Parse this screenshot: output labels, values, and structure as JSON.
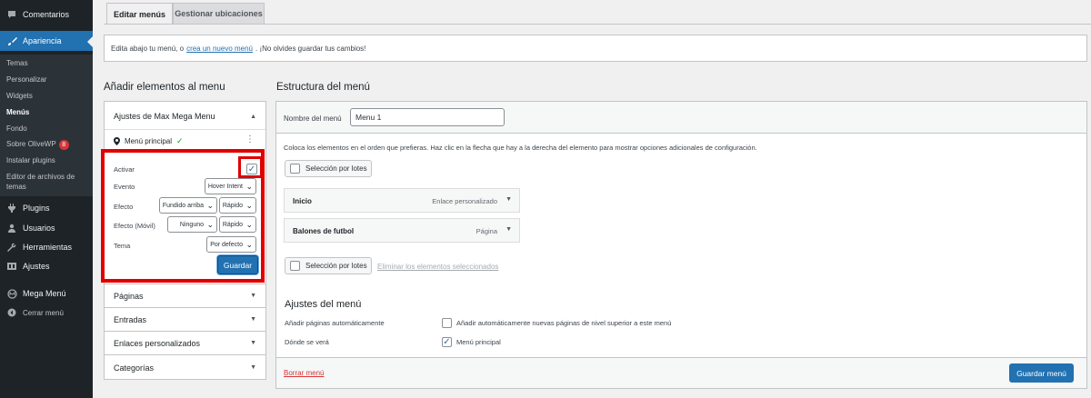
{
  "sidebar": {
    "top_items": [
      {
        "label": "Comentarios",
        "icon": "comment-icon"
      },
      {
        "label": "Apariencia",
        "icon": "brush-icon"
      }
    ],
    "sub_items": [
      "Temas",
      "Personalizar",
      "Widgets",
      "Menús",
      "Fondo",
      "Sobre OliveWP",
      "Instalar plugins",
      "Editor de archivos de temas"
    ],
    "badge": "8",
    "bottom_items": [
      {
        "label": "Plugins",
        "icon": "plugin-icon"
      },
      {
        "label": "Usuarios",
        "icon": "user-icon"
      },
      {
        "label": "Herramientas",
        "icon": "wrench-icon"
      },
      {
        "label": "Ajustes",
        "icon": "settings-icon"
      },
      {
        "label": "Mega Menú",
        "icon": "megamenu-icon"
      },
      {
        "label": "Cerrar menú",
        "icon": "collapse-icon"
      }
    ]
  },
  "tabs": [
    "Editar menús",
    "Gestionar ubicaciones"
  ],
  "notice": {
    "before": "Edita abajo tu menú, o",
    "link": "crea un nuevo menú",
    "after": ". ¡No olvides guardar tus cambios!"
  },
  "left": {
    "title": "Añadir elementos al menu",
    "megamenu_title": "Ajustes de Max Mega Menu",
    "location": "Menú principal",
    "settings": {
      "activar": "Activar",
      "evento": "Evento",
      "evento_value": "Hover Intent",
      "efecto": "Efecto",
      "efecto_value": "Fundido arriba",
      "efecto_speed": "Rápido",
      "efecto_movil": "Efecto (Móvil)",
      "efecto_movil_value": "Ninguno",
      "efecto_movil_speed": "Rápido",
      "tema": "Tema",
      "tema_value": "Por defecto",
      "save": "Guardar"
    },
    "sections": [
      "Páginas",
      "Entradas",
      "Enlaces personalizados",
      "Categorías"
    ]
  },
  "right": {
    "title": "Estructura del menú",
    "menu_name_label": "Nombre del menú",
    "menu_name_value": "Menu 1",
    "instructions": "Coloca los elementos en el orden que prefieras. Haz clic en la flecha que hay a la derecha del elemento para mostrar opciones adicionales de configuración.",
    "bulk_select": "Selección por lotes",
    "items": [
      {
        "title": "Inicio",
        "type": "Enlace personalizado"
      },
      {
        "title": "Balones de futbol",
        "type": "Página"
      }
    ],
    "remove_selected": "Eliminar los elementos seleccionados",
    "settings_title": "Ajustes del menú",
    "auto_add_label": "Añadir páginas automáticamente",
    "auto_add_option": "Añadir automáticamente nuevas páginas de nivel superior a este menú",
    "display_label": "Dónde se verá",
    "display_option": "Menú principal",
    "delete_menu": "Borrar menú",
    "save_menu": "Guardar menú"
  },
  "colors": {
    "accent": "#2271b1",
    "sidebar": "#1d2327",
    "highlight": "#e00000",
    "danger": "#d63638"
  }
}
